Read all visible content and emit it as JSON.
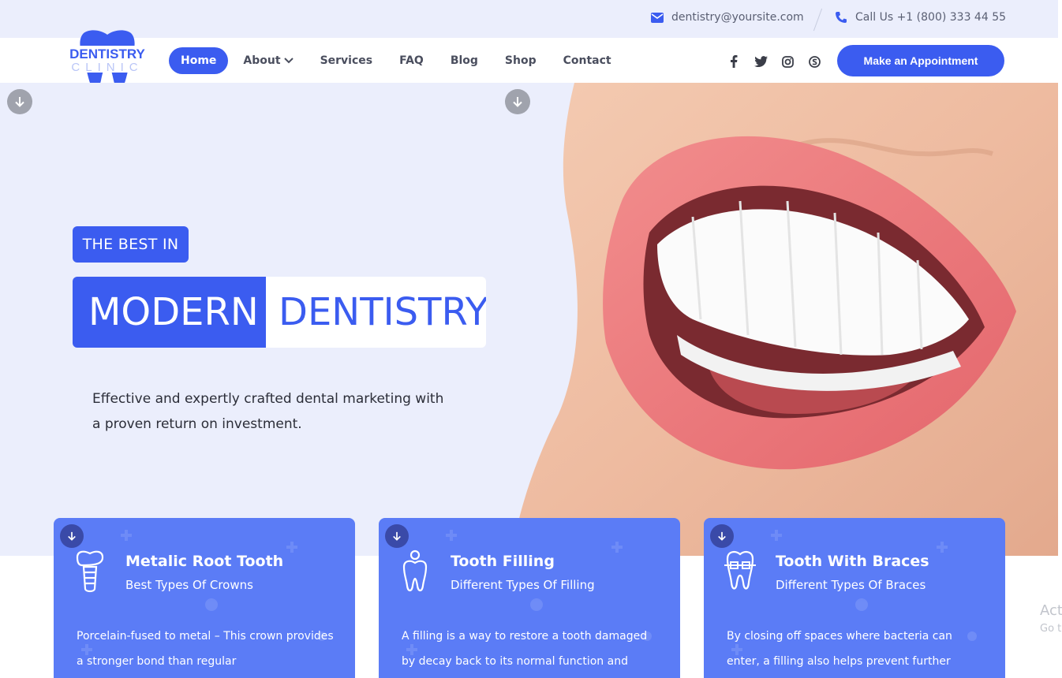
{
  "topbar": {
    "email": "dentistry@yoursite.com",
    "phone": "Call Us +1 (800) 333 44 55",
    "email_icon": "envelope-icon",
    "phone_icon": "phone-icon"
  },
  "logo": {
    "line1": "DENTISTRY",
    "line2": "CLINIC"
  },
  "nav": {
    "items": [
      {
        "label": "Home",
        "active": true
      },
      {
        "label": "About"
      },
      {
        "label": "Services"
      },
      {
        "label": "FAQ"
      },
      {
        "label": "Blog"
      },
      {
        "label": "Shop"
      },
      {
        "label": "Contact"
      }
    ],
    "cta": "Make an Appointment",
    "social": [
      "facebook-icon",
      "twitter-icon",
      "instagram-icon",
      "skype-icon"
    ]
  },
  "hero": {
    "kicker": "THE BEST IN",
    "headline_a": "MODERN",
    "headline_b": "DENTISTRY",
    "lead": "Effective and expertly crafted dental marketing with a proven return on investment."
  },
  "cards": [
    {
      "title": "Metalic Root Tooth",
      "subtitle": "Best Types Of Crowns",
      "body": "Porcelain-fused to metal – This crown provides a stronger bond than regular"
    },
    {
      "title": "Tooth Filling",
      "subtitle": "Different Types Of Filling",
      "body": "A filling is a way to restore a tooth damaged by decay back to its normal function and"
    },
    {
      "title": "Tooth With Braces",
      "subtitle": "Different Types Of Braces",
      "body": "By closing off spaces where bacteria can enter, a filling also helps prevent further"
    }
  ],
  "watermark": {
    "line1": "Act",
    "line2": "Go t"
  },
  "colors": {
    "brand": "#3b5cf0",
    "card": "#5b7cf6",
    "hero_bg": "#ebeefc"
  }
}
